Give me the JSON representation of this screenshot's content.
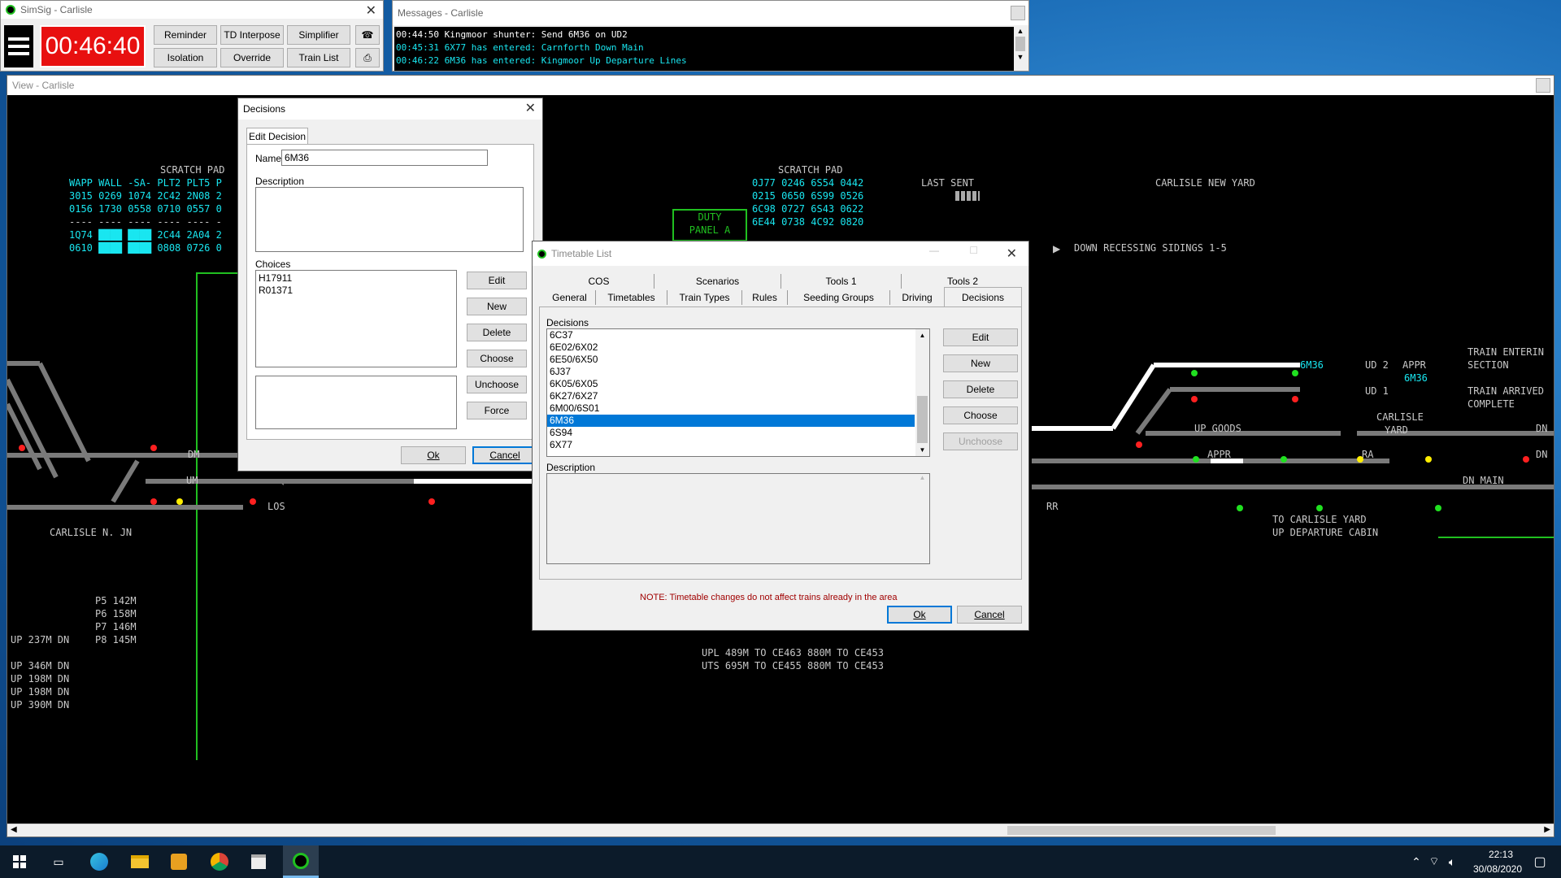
{
  "simsig": {
    "title": "SimSig - Carlisle",
    "clock": "00:46:40",
    "buttons_row1": [
      "Reminder",
      "TD Interpose",
      "Simplifier"
    ],
    "buttons_row2": [
      "Isolation",
      "Override",
      "Train List"
    ]
  },
  "messages": {
    "title": "Messages - Carlisle",
    "lines": [
      "00:44:50 Kingmoor shunter: Send 6M36 on UD2",
      "00:45:31 6X77 has entered: Carnforth Down Main",
      "00:46:22 6M36 has entered: Kingmoor Up Departure Lines"
    ]
  },
  "view": {
    "title": "View - Carlisle",
    "scratch_left_title": "SCRATCH PAD",
    "scratch_left_lines": [
      "WAPP WALL -SA- PLT2 PLT5 P",
      "3015 0269 1074 2C42 2N08 2",
      "0156 1730 0558 0710 0557 0",
      "---- ---- ---- ---- ---- -",
      "1Q74 ████ ████ 2C44 2A04 2",
      "0610 ████ ████ 0808 0726 0"
    ],
    "scratch_right_title": "SCRATCH PAD",
    "scratch_right_lines": [
      "0J77 0246 6S54 0442",
      "0215 0650 6S99 0526",
      "6C98 0727 6S43 0622",
      "6E44 0738 4C92 0820"
    ],
    "last_sent": "LAST SENT",
    "new_yard": "CARLISLE NEW YARD",
    "duty_panel": [
      "DUTY",
      "PANEL A"
    ],
    "down_recessing": "DOWN RECESSING SIDINGS 1-5",
    "dm": "DM",
    "um": "UM",
    "los": "LOS",
    "carlisle_n_jn": "CARLISLE N. JN",
    "platform_lengths": [
      "P5 142M",
      "P6 158M",
      "P7 146M",
      "P8 145M"
    ],
    "up_dn_line1": "UP 237M DN",
    "up_dn_lines": [
      "UP 346M DN",
      "UP 198M DN",
      "UP 198M DN",
      "UP 390M DN"
    ],
    "upl": "UPL 489M TO CE463 880M TO CE453",
    "uts": "UTS 695M TO CE455 880M TO CE453",
    "ud2": "UD 2",
    "ud1": "UD 1",
    "appr": "APPR",
    "appr2": "APPR",
    "berth_6m36_a": "6M36",
    "berth_6m36_b": "6M36",
    "train_entering": [
      "TRAIN ENTERIN",
      "SECTION"
    ],
    "train_arrived": [
      "TRAIN ARRIVED",
      "COMPLETE"
    ],
    "carlisle_yard": [
      "CARLISLE",
      "YARD"
    ],
    "up_goods": "UP GOODS",
    "ra": "RA",
    "dn_main": "DN MAIN",
    "rr": "RR",
    "to_yard": [
      "TO CARLISLE YARD",
      "UP DEPARTURE CABIN"
    ],
    "dn1": "DN",
    "dn2": "DN"
  },
  "decisions": {
    "title": "Decisions",
    "tab": "Edit Decision",
    "name_label": "Name",
    "name_value": "6M36",
    "description_label": "Description",
    "choices_label": "Choices",
    "choices": [
      "H17911",
      "R01371"
    ],
    "buttons": [
      "Edit",
      "New",
      "Delete",
      "Choose",
      "Unchoose",
      "Force"
    ],
    "ok": "Ok",
    "cancel": "Cancel"
  },
  "timetable": {
    "title": "Timetable List",
    "tabs_row1": [
      "COS",
      "Scenarios",
      "Tools 1",
      "Tools 2"
    ],
    "tabs_row2": [
      "General",
      "Timetables",
      "Train Types",
      "Rules",
      "Seeding Groups",
      "Driving",
      "Decisions"
    ],
    "decisions_label": "Decisions",
    "items": [
      "6C37",
      "6E02/6X02",
      "6E50/6X50",
      "6J37",
      "6K05/6X05",
      "6K27/6X27",
      "6M00/6S01",
      "6M36",
      "6S94",
      "6X77"
    ],
    "selected": "6M36",
    "description_label": "Description",
    "buttons": [
      "Edit",
      "New",
      "Delete",
      "Choose",
      "Unchoose"
    ],
    "note": "NOTE: Timetable changes do not affect trains already in the area",
    "ok": "Ok",
    "cancel": "Cancel"
  },
  "taskbar": {
    "time": "22:13",
    "date": "30/08/2020"
  }
}
